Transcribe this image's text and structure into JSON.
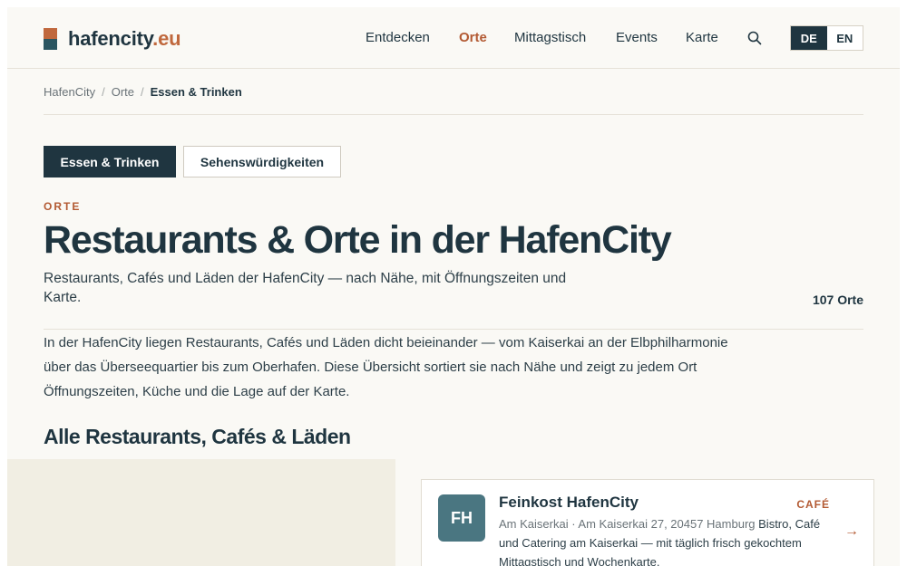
{
  "brand": {
    "name": "hafencity",
    "tld": ".eu"
  },
  "nav": {
    "items": [
      "Entdecken",
      "Orte",
      "Mittagstisch",
      "Events",
      "Karte"
    ],
    "active": "Orte"
  },
  "lang": {
    "de": "DE",
    "en": "EN",
    "active": "DE"
  },
  "breadcrumb": {
    "items": [
      "HafenCity",
      "Orte",
      "Essen & Trinken"
    ]
  },
  "tabs": [
    "Essen & Trinken",
    "Sehenswürdigkeiten"
  ],
  "hero": {
    "eyebrow": "ORTE",
    "title": "Restaurants & Orte in der HafenCity",
    "subtitle": "Restaurants, Cafés und Läden der HafenCity — nach Nähe, mit Öffnungszeiten und Karte.",
    "count": "107 Orte"
  },
  "intro": "In der HafenCity liegen Restaurants, Cafés und Läden dicht beieinander — vom Kaiserkai an der Elbphilharmonie über das Überseequartier bis zum Oberhafen. Diese Übersicht sortiert sie nach Nähe und zeigt zu jedem Ort Öffnungszeiten, Küche und die Lage auf der Karte.",
  "section_title": "Alle Restaurants, Cafés & Läden",
  "listing": {
    "initials": "FH",
    "name": "Feinkost HafenCity",
    "category": "CAFÉ",
    "address": "Am Kaiserkai · Am Kaiserkai 27, 20457 Hamburg",
    "description": "Bistro, Café und Catering am Kaiserkai — mit täglich frisch gekochtem Mittagstisch und Wochenkarte.",
    "arrow": "→"
  },
  "colors": {
    "primary": "#1f3540",
    "accent": "#b35a33",
    "background": "#faf9f5"
  }
}
